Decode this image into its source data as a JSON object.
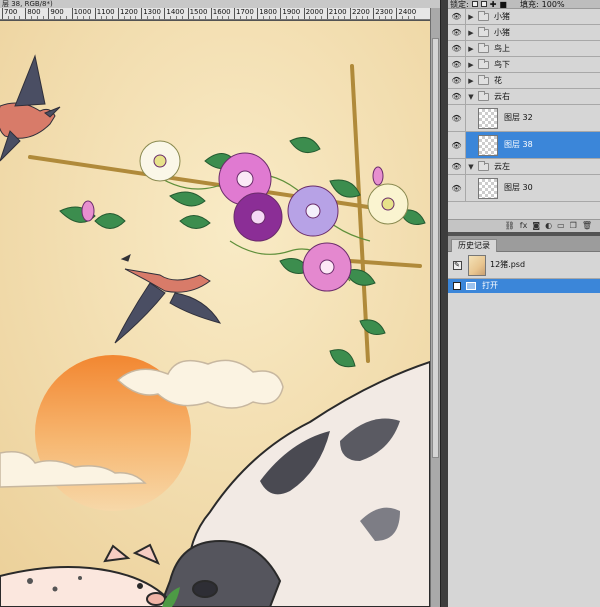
{
  "document": {
    "tab_text": "层 38, RGB/8*)",
    "ruler_labels": [
      "700",
      "800",
      "900",
      "1000",
      "1100",
      "1200",
      "1300",
      "1400",
      "1500",
      "1600",
      "1700",
      "1800",
      "1900",
      "2000",
      "2100",
      "2200",
      "2300",
      "2400"
    ]
  },
  "layers_panel": {
    "lock_label": "锁定:",
    "fill_label": "填充:",
    "fill_value": "100%",
    "layers": [
      {
        "name": "小猪",
        "type": "group",
        "expanded": false
      },
      {
        "name": "小猪",
        "type": "group",
        "expanded": false
      },
      {
        "name": "鸟上",
        "type": "group",
        "expanded": false
      },
      {
        "name": "鸟下",
        "type": "group",
        "expanded": false
      },
      {
        "name": "花",
        "type": "group",
        "expanded": false
      },
      {
        "name": "云右",
        "type": "group",
        "expanded": true
      },
      {
        "name": "图层 32",
        "type": "layer",
        "selected": false
      },
      {
        "name": "图层 38",
        "type": "layer",
        "selected": true
      },
      {
        "name": "云左",
        "type": "group",
        "expanded": true
      },
      {
        "name": "图层 30",
        "type": "layer",
        "selected": false
      }
    ],
    "footer_icons": [
      "link-icon",
      "fx-icon",
      "mask-icon",
      "adjustment-icon",
      "new-group-icon",
      "new-layer-icon",
      "trash-icon"
    ]
  },
  "history_panel": {
    "tab_label": "历史记录",
    "snapshot_name": "12猪.psd",
    "items": [
      {
        "label": "打开",
        "selected": true
      }
    ]
  },
  "colors": {
    "selection": "#3b86d9",
    "panel_bg": "#d6d6d6",
    "workspace": "#535353"
  }
}
